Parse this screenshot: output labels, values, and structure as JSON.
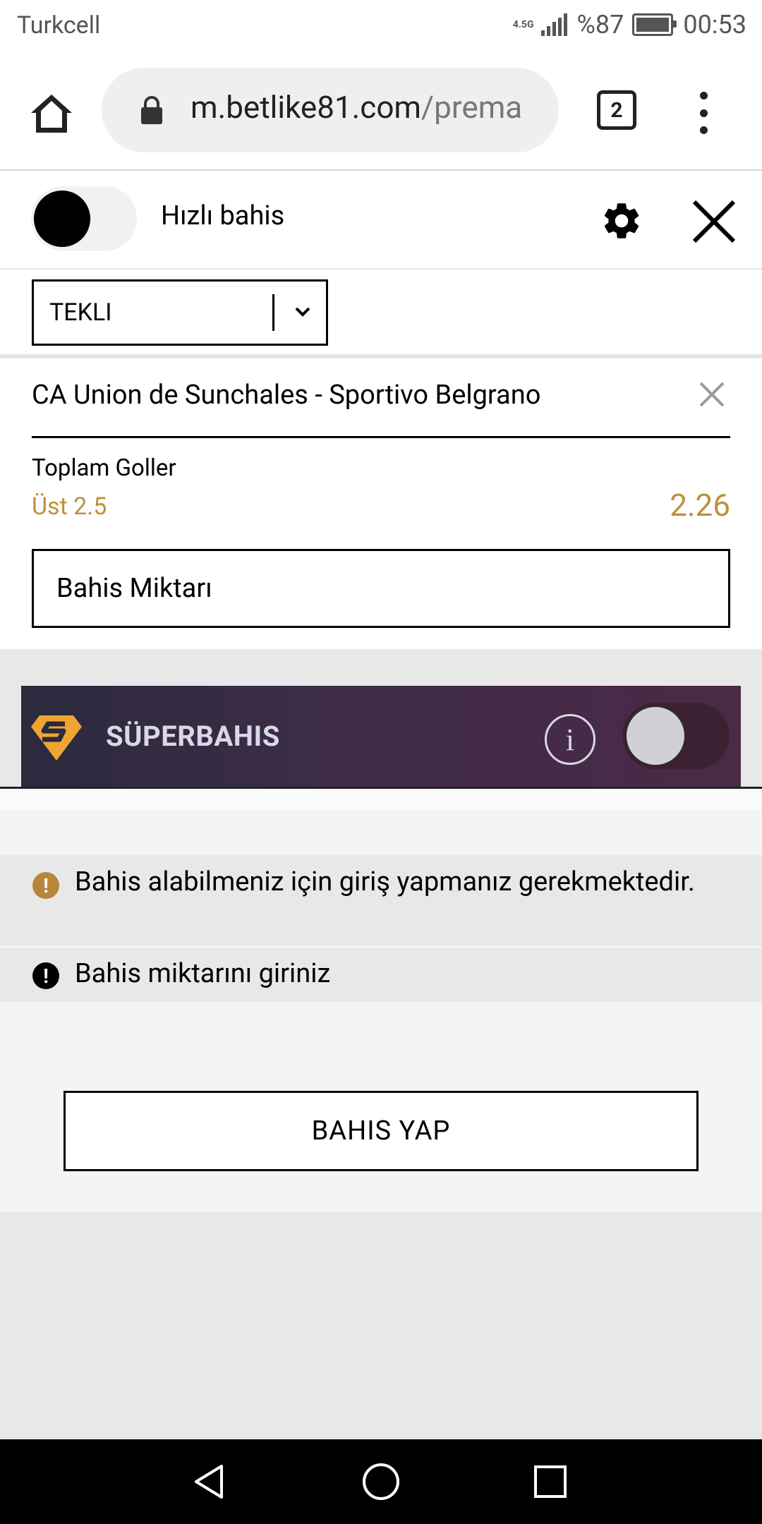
{
  "status_bar": {
    "carrier": "Turkcell",
    "network": "4.5G",
    "battery": "%87",
    "battery_level": 0.87,
    "time": "00:53"
  },
  "browser": {
    "url_domain": "m.betlike81.com",
    "url_path": "/prema",
    "tab_count": "2"
  },
  "betslip": {
    "quick_bet_label": "Hızlı bahis",
    "quick_bet_on": false,
    "bet_type": "TEKLI",
    "selection": {
      "match": "CA Union de Sunchales - Sportivo Belgrano",
      "market": "Toplam Goller",
      "pick": "Üst 2.5",
      "odds": "2.26"
    },
    "stake_placeholder": "Bahis Miktarı",
    "superbahis": {
      "label": "SÜPERBAHIS",
      "info_icon": "i",
      "enabled": false
    },
    "messages": [
      {
        "icon": "!",
        "text": "Bahis alabilmeniz için giriş yapmanız gerekmektedir.",
        "color": "#b8863b"
      },
      {
        "icon": "!",
        "text": "Bahis miktarını giriniz",
        "color": "#000000"
      }
    ],
    "submit_label": "BAHIS YAP"
  },
  "colors": {
    "accent": "#bd913c",
    "banner_start": "#2b2a3e",
    "banner_end": "#4b2a47"
  }
}
